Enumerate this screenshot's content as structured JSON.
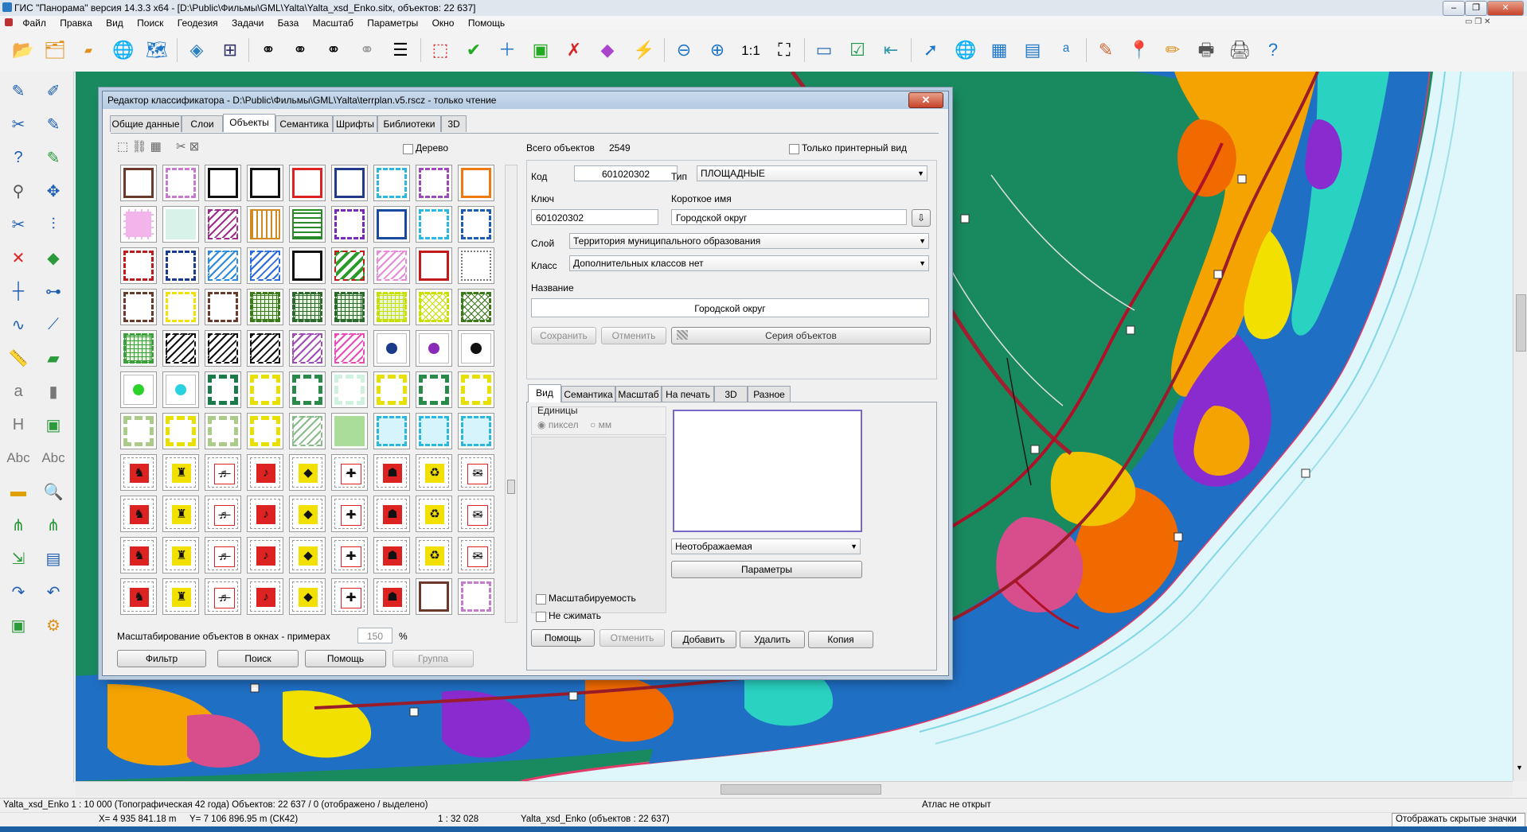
{
  "app": {
    "title": "ГИС \"Панорама\" версия 14.3.3 x64 - [D:\\Public\\Фильмы\\GML\\Yalta\\Yalta_xsd_Enko.sitx, объектов: 22 637]",
    "window_buttons": [
      "–",
      "❐",
      "✕"
    ]
  },
  "menu": [
    "Файл",
    "Правка",
    "Вид",
    "Поиск",
    "Геодезия",
    "Задачи",
    "База",
    "Масштаб",
    "Параметры",
    "Окно",
    "Помощь"
  ],
  "toolbar": {
    "scale_label": "1:1"
  },
  "dialog": {
    "title": "Редактор классификатора - D:\\Public\\Фильмы\\GML\\Yalta\\terrplan.v5.rscz - только чтение",
    "close": "✕",
    "tabs": [
      "Общие данные",
      "Слои",
      "Объекты",
      "Семантика",
      "Шрифты",
      "Библиотеки",
      "3D"
    ],
    "active_tab": "Объекты",
    "tree_label": "Дерево",
    "total_label": "Всего объектов",
    "total_value": "2549",
    "printer_only_label": "Только принтерный вид",
    "code_label": "Код",
    "code_value": "601020302",
    "type_label": "Тип",
    "type_value": "ПЛОЩАДНЫЕ",
    "key_label": "Ключ",
    "key_value": "601020302",
    "short_name_label": "Короткое имя",
    "short_name_value": "Городской округ",
    "layer_label": "Слой",
    "layer_value": "Территория муниципального образования",
    "class_label": "Класс",
    "class_value": "Дополнительных классов нет",
    "name_label": "Название",
    "name_value": "Городской округ",
    "save_btn": "Сохранить",
    "cancel_btn": "Отменить",
    "series_btn": "Серия объектов",
    "subtabs": [
      "Вид",
      "Семантика",
      "Масштаб",
      "На печать",
      "3D",
      "Разное"
    ],
    "active_subtab": "Вид",
    "units_label": "Единицы",
    "unit_pixel": "пиксел",
    "unit_mm": "мм",
    "display_value": "Неотображаемая",
    "params_btn": "Параметры",
    "scalable_label": "Масштабируемость",
    "nocompress_label": "Не сжимать",
    "help_btn": "Помощь",
    "cancel2_btn": "Отменить",
    "add_btn": "Добавить",
    "delete_btn": "Удалить",
    "copy_btn": "Копия",
    "scale_examples_label": "Масштабирование объектов в окнах - примерах",
    "scale_examples_value": "150",
    "percent": "%",
    "filter_btn": "Фильтр",
    "search_btn": "Поиск",
    "help2_btn": "Помощь",
    "group_btn": "Группа"
  },
  "status": {
    "line1_left": "Yalta_xsd_Enko  1 : 10 000 (Топографическая 42 года) Объектов: 22 637 / 0 (отображено / выделено)",
    "line1_right": "Атлас не открыт",
    "coord_x": "X= 4 935 841.18 m",
    "coord_y": "Y= 7 106 896.95 m  (СК42)",
    "scale": "1 : 32 028",
    "map_objects": "Yalta_xsd_Enko   (объектов : 22 637)",
    "hidden_icons": "Отображать скрытые значки"
  },
  "colors": {
    "map_green": "#198a5f",
    "sea": "#dff6fb",
    "dialog_border": "#6b7f98",
    "accent_red": "#d82020"
  },
  "icons": {
    "toolbar": [
      "open-folder-icon",
      "open-folder-icon",
      "dbm-folder-icon",
      "globe-icon",
      "globe-doc-icon",
      "layers-icon",
      "tree-icon",
      "binoculars-icon",
      "binoculars-text-icon",
      "binoculars-dots-icon",
      "binoculars-dim-icon",
      "list-icon",
      "select-object-icon",
      "select-green-icon",
      "select-add-icon",
      "select-area-icon",
      "select-cancel-icon",
      "cube-icon",
      "lightning-icon",
      "zoom-out-icon",
      "zoom-in-icon",
      "scale-1-1-icon",
      "fit-extent-icon",
      "window-icon",
      "checkmark-icon",
      "back-arrow-icon",
      "cursor-icon",
      "globe-cursor-icon",
      "table-cursor-icon",
      "dbm-cursor-icon",
      "text-cursor-icon",
      "paint-icon",
      "map-pin-icon",
      "ruler-pen-icon",
      "printer-icon",
      "printer-settings-icon",
      "help-cursor-icon"
    ],
    "left": [
      "pen-icon",
      "pen-icon",
      "pen-cut-icon",
      "pen-edit-icon",
      "pen-query-icon",
      "pen-green-icon",
      "compass-icon",
      "move-arrows-icon",
      "scissors-icon",
      "split-icon",
      "delete-x-icon",
      "ruler-green-icon",
      "node-add-icon",
      "node-move-icon",
      "polyline-icon",
      "polyline-edit-icon",
      "ruler-icon",
      "measure-icon",
      "torch-text-icon",
      "torch-icon",
      "height-icon",
      "green-edit-icon",
      "abc-icon",
      "abc-outline-icon",
      "torch-icon",
      "magnifier-icon",
      "network-icon",
      "network-edit-icon",
      "map-arrow-icon",
      "table-icon",
      "undo-icon",
      "redo-icon",
      "image-icon",
      "gear-icon"
    ]
  }
}
